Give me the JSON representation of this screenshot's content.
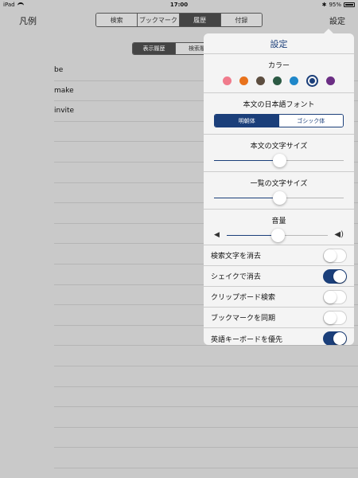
{
  "status": {
    "device": "iPad",
    "time": "17:00",
    "battery": "95%"
  },
  "nav": {
    "left": "凡例",
    "right": "設定",
    "tabs": [
      {
        "label": "検索",
        "active": false
      },
      {
        "label": "ブックマーク",
        "active": false
      },
      {
        "label": "履歴",
        "active": true
      },
      {
        "label": "付録",
        "active": false
      }
    ]
  },
  "history_tabs": [
    {
      "label": "表示履歴",
      "active": true
    },
    {
      "label": "検索履",
      "active": false
    }
  ],
  "history_items": [
    "be",
    "make",
    "invite"
  ],
  "settings": {
    "title": "設定",
    "color_label": "カラー",
    "colors": [
      {
        "name": "pink",
        "hex": "#f07b8c"
      },
      {
        "name": "orange",
        "hex": "#e8721c"
      },
      {
        "name": "brown",
        "hex": "#5d4e40"
      },
      {
        "name": "green",
        "hex": "#2c5a44"
      },
      {
        "name": "blue",
        "hex": "#1f87c9"
      },
      {
        "name": "navy",
        "hex": "#1b3f7a",
        "selected": true
      },
      {
        "name": "purple",
        "hex": "#6b2e84"
      }
    ],
    "font_label": "本文の日本語フォント",
    "font_options": [
      {
        "label": "明朝体",
        "active": true
      },
      {
        "label": "ゴシック体",
        "active": false
      }
    ],
    "body_size_label": "本文の文字サイズ",
    "body_size_value": 0.5,
    "list_size_label": "一覧の文字サイズ",
    "list_size_value": 0.5,
    "volume_label": "音量",
    "volume_value": 0.5,
    "toggles": [
      {
        "label": "検索文字を消去",
        "on": false
      },
      {
        "label": "シェイクで消去",
        "on": true
      },
      {
        "label": "クリップボード検索",
        "on": false
      },
      {
        "label": "ブックマークを同期",
        "on": false
      },
      {
        "label": "英語キーボードを優先",
        "on": true
      }
    ]
  }
}
